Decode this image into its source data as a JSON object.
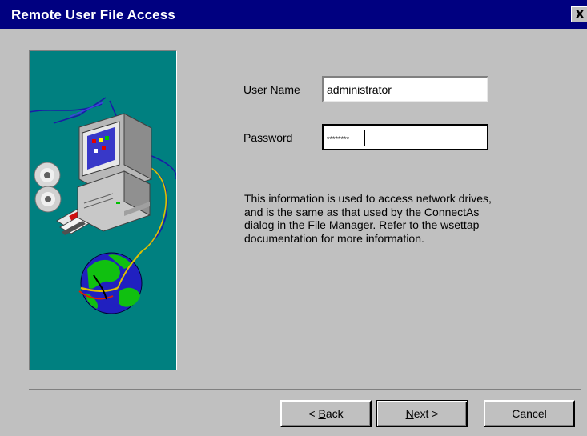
{
  "window": {
    "title": "Remote User File Access",
    "close_label": "X"
  },
  "form": {
    "username_label": "User Name",
    "username_value": "administrator",
    "password_label": "Password",
    "password_value": "********"
  },
  "info_text": "This information is used to access network drives, and is the same as that used by the ConnectAs dialog in the File Manager.  Refer to the wsettap documentation for more information.",
  "buttons": {
    "back_mnemonic": "B",
    "back_rest": "ack",
    "back_prefix": "< ",
    "next_mnemonic": "N",
    "next_rest": "ext >",
    "cancel_label": "Cancel"
  },
  "colors": {
    "title_bar": "#000080",
    "panel_bg": "#008080",
    "dialog_bg": "#c0c0c0"
  },
  "illustration": {
    "icons": [
      "computer-icon",
      "cd-icon",
      "floppy-disk-icon",
      "globe-icon",
      "network-cable-icon"
    ]
  }
}
